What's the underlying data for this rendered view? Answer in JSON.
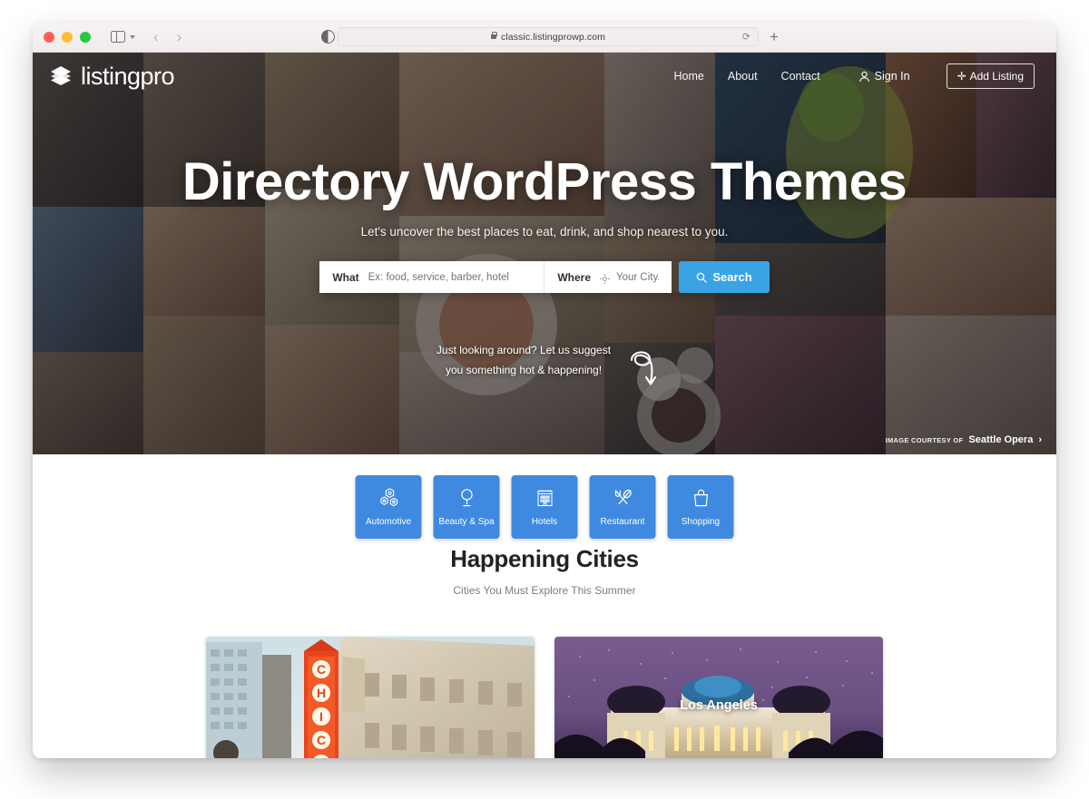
{
  "browser": {
    "url": "classic.listingprowp.com",
    "lock_icon": "lock-icon",
    "reload_icon": "reload-icon",
    "new_tab_icon": "plus-icon",
    "back_arrow": "‹",
    "forward_arrow": "›",
    "sidebar_icon": "sidebar-toggle-icon",
    "contrast_icon": "contrast-icon",
    "traffic_lights": [
      "close",
      "minimize",
      "zoom"
    ]
  },
  "site": {
    "logo_text": "listingpro",
    "logo_icon": "layers-icon",
    "nav": [
      {
        "label": "Home"
      },
      {
        "label": "About"
      },
      {
        "label": "Contact"
      }
    ],
    "sign_in": {
      "label": "Sign In",
      "icon": "user-icon"
    },
    "add_listing": {
      "label": "Add Listing",
      "icon": "plus-icon"
    }
  },
  "hero": {
    "title": "Directory WordPress Themes",
    "subtitle": "Let's uncover the best places to eat, drink, and shop nearest to you.",
    "search": {
      "what_label": "What",
      "what_placeholder": "Ex: food, service, barber, hotel",
      "what_value": "",
      "where_label": "Where",
      "where_placeholder": "Your City...",
      "where_value": "",
      "where_icon": "geolocate-icon",
      "button_label": "Search",
      "button_icon": "search-icon",
      "button_color": "#39a3e3"
    },
    "suggest_text": "Just looking around? Let us suggest you something hot & happening!",
    "suggest_arrow_icon": "curved-arrow-icon",
    "courtesy_prefix": "IMAGE COURTESY OF",
    "courtesy_name": "Seattle Opera",
    "courtesy_chevron": "›"
  },
  "categories": {
    "tile_color": "#3f8ae0",
    "items": [
      {
        "label": "Automotive",
        "icon": "gears-icon"
      },
      {
        "label": "Beauty & Spa",
        "icon": "mirror-icon"
      },
      {
        "label": "Hotels",
        "icon": "building-icon"
      },
      {
        "label": "Restaurant",
        "icon": "cutlery-icon"
      },
      {
        "label": "Shopping",
        "icon": "shopping-bag-icon"
      }
    ]
  },
  "cities": {
    "title": "Happening Cities",
    "subtitle": "Cities You Must Explore This Summer",
    "items": [
      {
        "name": "Chicago",
        "name_visible": ""
      },
      {
        "name": "Los Angeles",
        "name_visible": "Los Angeles"
      }
    ]
  }
}
